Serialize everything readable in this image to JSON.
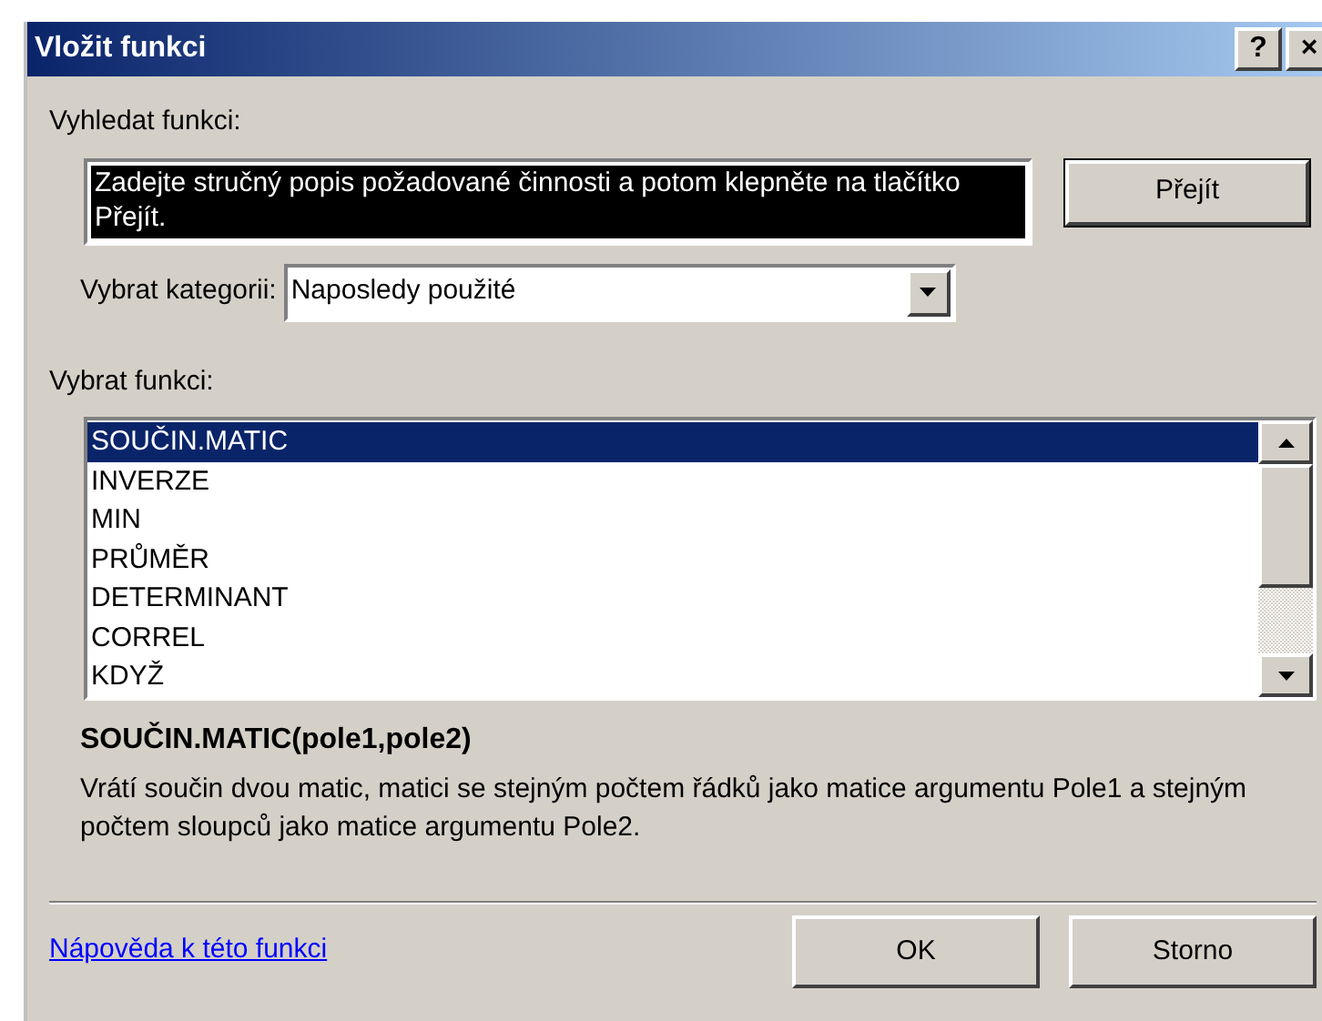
{
  "window": {
    "title": "Vložit funkci",
    "title_buttons": [
      "?",
      "×"
    ]
  },
  "search": {
    "label": "Vyhledat funkci:",
    "value": "Zadejte stručný popis požadované činnosti a potom klepněte na tlačítko Přejít.",
    "value_selected": true,
    "button": "Přejít"
  },
  "category": {
    "label": "Vybrat kategorii:",
    "value": "Naposledy použité"
  },
  "functions": {
    "label": "Vybrat funkci:",
    "items": [
      {
        "name": "SOUČIN.MATIC",
        "selected": true
      },
      {
        "name": "INVERZE",
        "selected": false
      },
      {
        "name": "MIN",
        "selected": false
      },
      {
        "name": "PRŮMĚR",
        "selected": false
      },
      {
        "name": "DETERMINANT",
        "selected": false
      },
      {
        "name": "CORREL",
        "selected": false
      },
      {
        "name": "KDYŽ",
        "selected": false
      }
    ]
  },
  "signature": "SOUČIN.MATIC(pole1,pole2)",
  "description": "Vrátí součin dvou matic, matici se stejným počtem řádků jako matice argumentu Pole1 a stejným počtem sloupců jako matice argumentu Pole2.",
  "help_link": "Nápověda k této funkci",
  "buttons": [
    "OK",
    "Storno"
  ]
}
